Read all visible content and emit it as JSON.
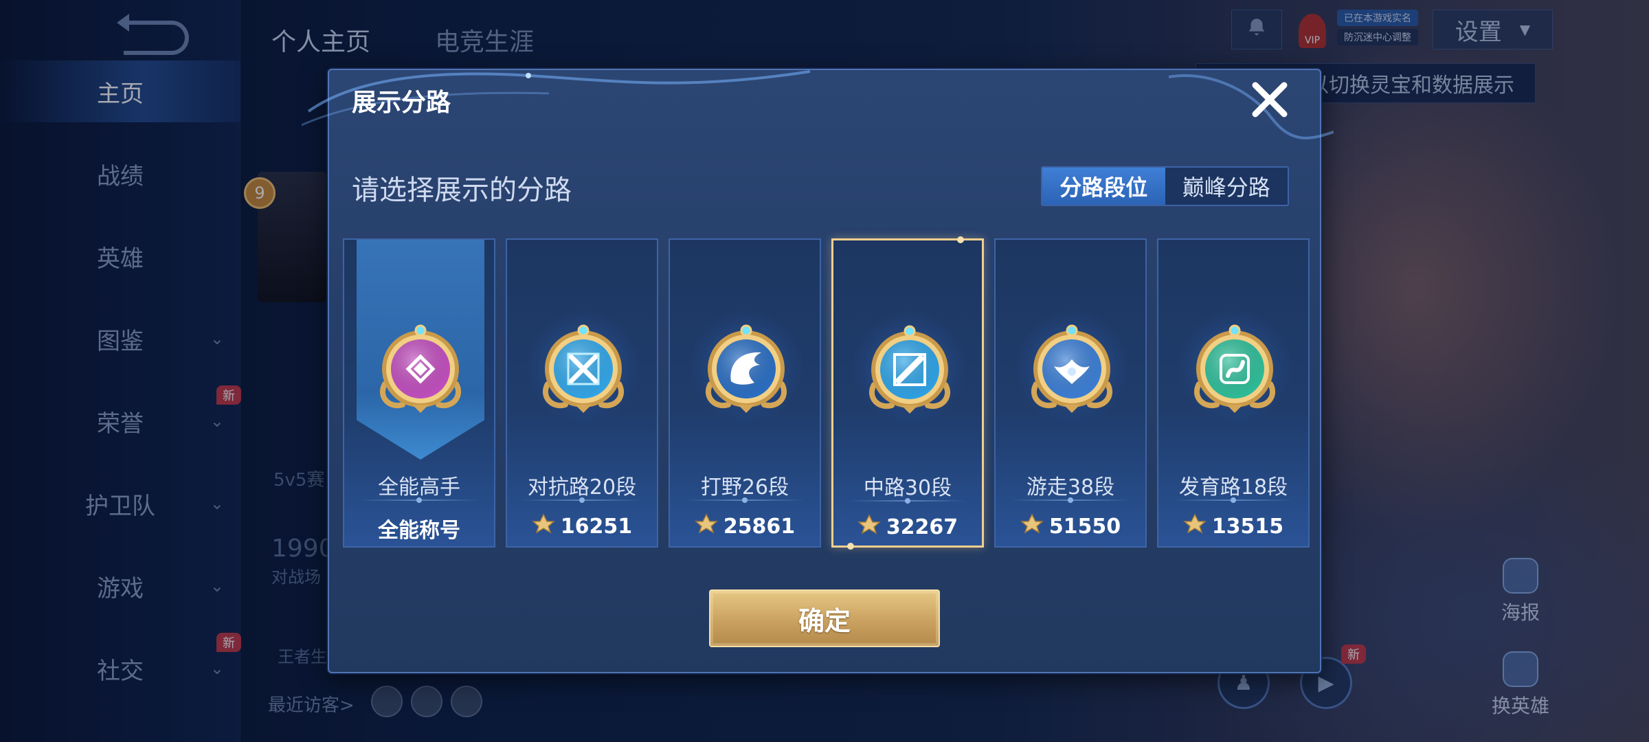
{
  "background": {
    "top_tabs": [
      "个人主页",
      "电竞生涯"
    ],
    "nav_items": [
      {
        "label": "主页",
        "active": true,
        "chevron": false,
        "new": false
      },
      {
        "label": "战绩",
        "active": false,
        "chevron": false,
        "new": false
      },
      {
        "label": "英雄",
        "active": false,
        "chevron": false,
        "new": false
      },
      {
        "label": "图鉴",
        "active": false,
        "chevron": true,
        "new": false
      },
      {
        "label": "荣誉",
        "active": false,
        "chevron": true,
        "new": true
      },
      {
        "label": "护卫队",
        "active": false,
        "chevron": true,
        "new": false
      },
      {
        "label": "游戏",
        "active": false,
        "chevron": true,
        "new": false
      },
      {
        "label": "社交",
        "active": false,
        "chevron": true,
        "new": true
      }
    ],
    "new_tag": "新",
    "level": "9",
    "text_5v5": "5v5赛",
    "number_text": "1990",
    "match_text": "对战场",
    "king_text": "王者生",
    "recent_visitors": "最近访客>",
    "settings_label": "设置",
    "tooltip_text": "以切换灵宝和数据展示",
    "pill_top": "已在本游戏实名",
    "pill_bottom": "防沉迷中心调整",
    "vip": "VIP",
    "poster_label": "海报",
    "switch_hero_label": "换英雄"
  },
  "modal": {
    "title": "展示分路",
    "subtitle": "请选择展示的分路",
    "segments": [
      {
        "label": "分路段位",
        "active": true
      },
      {
        "label": "巅峰分路",
        "active": false
      }
    ],
    "cards": [
      {
        "label": "全能高手",
        "value": "全能称号",
        "score_icon": false,
        "emblem": "allrounder-emblem-icon",
        "color": "#c24fbf",
        "selected": false,
        "banner": true
      },
      {
        "label": "对抗路20段",
        "value": "16251",
        "score_icon": true,
        "emblem": "clash-lane-emblem-icon",
        "color": "#33a6e8",
        "selected": false,
        "banner": false
      },
      {
        "label": "打野26段",
        "value": "25861",
        "score_icon": true,
        "emblem": "jungle-emblem-icon",
        "color": "#2b6fc4",
        "selected": false,
        "banner": false
      },
      {
        "label": "中路30段",
        "value": "32267",
        "score_icon": true,
        "emblem": "mid-lane-emblem-icon",
        "color": "#2fa3e6",
        "selected": true,
        "banner": false
      },
      {
        "label": "游走38段",
        "value": "51550",
        "score_icon": true,
        "emblem": "roam-emblem-icon",
        "color": "#3c7fd6",
        "selected": false,
        "banner": false
      },
      {
        "label": "发育路18段",
        "value": "13515",
        "score_icon": true,
        "emblem": "farm-lane-emblem-icon",
        "color": "#2fbf9a",
        "selected": false,
        "banner": false
      }
    ],
    "confirm_label": "确定"
  }
}
